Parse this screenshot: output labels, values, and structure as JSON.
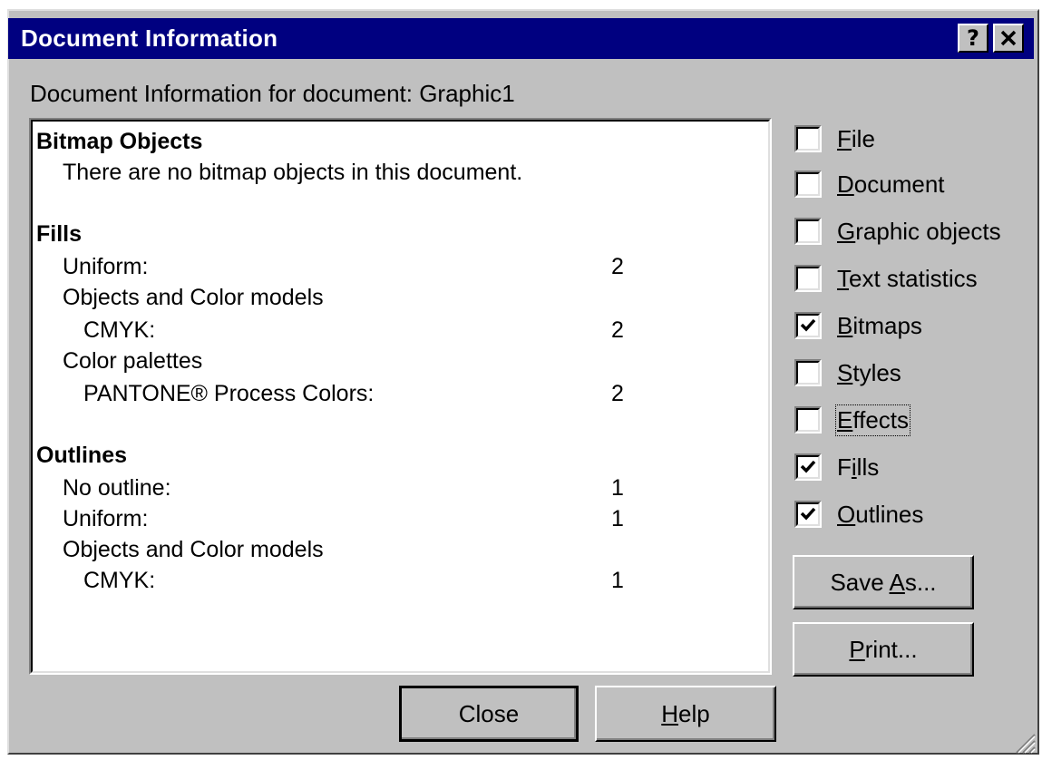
{
  "window": {
    "title": "Document Information",
    "help_glyph": "?",
    "close_glyph": "✕"
  },
  "document_label": "Document Information for document: Graphic1",
  "report": {
    "bitmap_heading": "Bitmap Objects",
    "bitmap_text": "There are no bitmap objects in this document.",
    "fills_heading": "Fills",
    "fills": [
      {
        "label": "Uniform:",
        "value": "2"
      },
      {
        "label": "Objects and Color models",
        "value": ""
      },
      {
        "label": "CMYK:",
        "value": "2"
      },
      {
        "label": "Color palettes",
        "value": ""
      },
      {
        "label": "PANTONE® Process Colors:",
        "value": "2"
      }
    ],
    "outlines_heading": "Outlines",
    "outlines": [
      {
        "label": "No outline:",
        "value": "1"
      },
      {
        "label": "Uniform:",
        "value": "1"
      },
      {
        "label": "Objects and Color models",
        "value": ""
      },
      {
        "label": "CMYK:",
        "value": "1"
      }
    ]
  },
  "checkboxes": [
    {
      "label": "File",
      "mnemonic": "F",
      "rest": "ile",
      "checked": false
    },
    {
      "label": "Document",
      "mnemonic": "D",
      "rest": "ocument",
      "checked": false
    },
    {
      "label": "Graphic objects",
      "mnemonic": "G",
      "rest": "raphic objects",
      "checked": false
    },
    {
      "label": "Text statistics",
      "mnemonic": "T",
      "rest": "ext statistics",
      "checked": false
    },
    {
      "label": "Bitmaps",
      "mnemonic": "B",
      "rest": "itmaps",
      "checked": true
    },
    {
      "label": "Styles",
      "mnemonic": "S",
      "rest": "tyles",
      "checked": false
    },
    {
      "label": "Effects",
      "mnemonic": "E",
      "rest": "ffects",
      "checked": false
    },
    {
      "label": "Fills",
      "pre": "F",
      "mnemonic": "i",
      "rest": "lls",
      "checked": true
    },
    {
      "label": "Outlines",
      "mnemonic": "O",
      "rest": "utlines",
      "checked": true
    }
  ],
  "buttons": {
    "save_as_pre": "Save ",
    "save_as_mnemonic": "A",
    "save_as_post": "s...",
    "print_mnemonic": "P",
    "print_post": "rint...",
    "close": "Close",
    "help_mnemonic": "H",
    "help_post": "elp"
  },
  "colors": {
    "titlebar": "#000080",
    "face": "#c0c0c0"
  }
}
